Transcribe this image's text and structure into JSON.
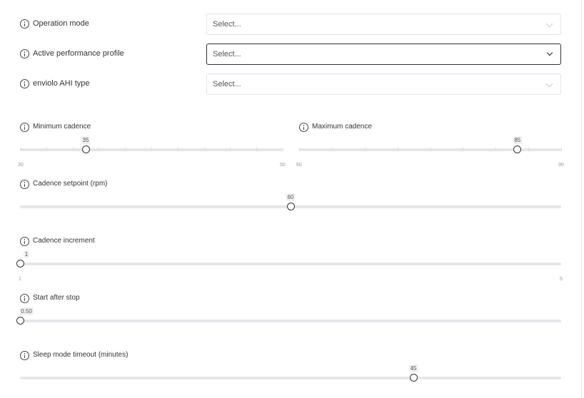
{
  "selects": [
    {
      "label": "Operation mode",
      "value": "Select..."
    },
    {
      "label": "Active performance profile",
      "value": "Select..."
    },
    {
      "label": "enviolo AHI type",
      "value": "Select..."
    }
  ],
  "sliders": {
    "min_cadence": {
      "label": "Minimum cadence",
      "min": 30,
      "max": 50,
      "value": 35,
      "value_text": "35",
      "min_text": "30",
      "max_text": "50"
    },
    "max_cadence": {
      "label": "Maximum cadence",
      "min": 60,
      "max": 90,
      "value": 85,
      "value_text": "85",
      "min_text": "60",
      "max_text": "90"
    },
    "cadence_setpoint": {
      "label": "Cadence setpoint (rpm)",
      "value": 60,
      "value_text": "60",
      "fraction": 0.5
    },
    "cadence_increment": {
      "label": "Cadence increment",
      "min": 1,
      "max": 5,
      "value": 1,
      "value_text": "1",
      "min_text": "1",
      "max_text": "5"
    },
    "start_after_stop": {
      "label": "Start after stop",
      "value": 0.5,
      "value_text": "0.50",
      "fraction": 0.0
    },
    "sleep_timeout": {
      "label": "Sleep mode timeout (minutes)",
      "value": 45,
      "value_text": "45",
      "fraction": 0.727
    }
  }
}
